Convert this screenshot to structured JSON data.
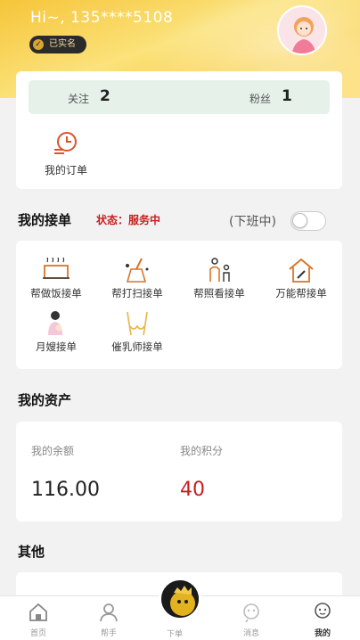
{
  "header": {
    "greeting": "Hi~, 135****5108",
    "verified_badge": "已实名",
    "avatar_icon": "user-avatar-icon"
  },
  "social": {
    "following_label": "关注",
    "following_count": "2",
    "followers_label": "粉丝",
    "followers_count": "1"
  },
  "orders": {
    "label": "我的订单",
    "icon": "order-clock-icon"
  },
  "my_orders_section": {
    "title": "我的接单",
    "status": "状态：服务中",
    "offline_label": "(下班中)",
    "toggle_on": false
  },
  "services": [
    {
      "label": "帮做饭接单",
      "icon": "cooking-icon"
    },
    {
      "label": "帮打扫接单",
      "icon": "broom-icon"
    },
    {
      "label": "帮照看接单",
      "icon": "caregiver-icon"
    },
    {
      "label": "万能帮接单",
      "icon": "house-tools-icon"
    },
    {
      "label": "月嫂接单",
      "icon": "nanny-baby-icon"
    },
    {
      "label": "催乳师接单",
      "icon": "lactation-icon"
    }
  ],
  "assets": {
    "title": "我的资产",
    "balance_label": "我的余额",
    "balance_value": "116.00",
    "points_label": "我的积分",
    "points_value": "40",
    "points_color": "#c81e1e"
  },
  "other": {
    "title": "其他"
  },
  "tabbar": {
    "items": [
      {
        "label": "首页",
        "icon": "home-icon"
      },
      {
        "label": "帮手",
        "icon": "helper-icon"
      },
      {
        "label": "下单",
        "icon": "order-center-icon"
      },
      {
        "label": "消息",
        "icon": "message-icon"
      },
      {
        "label": "我的",
        "icon": "profile-icon"
      }
    ]
  },
  "colors": {
    "header_yellow": "#f6c53a",
    "accent_red": "#c81e1e",
    "follow_bar_bg": "#e6f1ea",
    "icon_orange": "#d9742b"
  }
}
